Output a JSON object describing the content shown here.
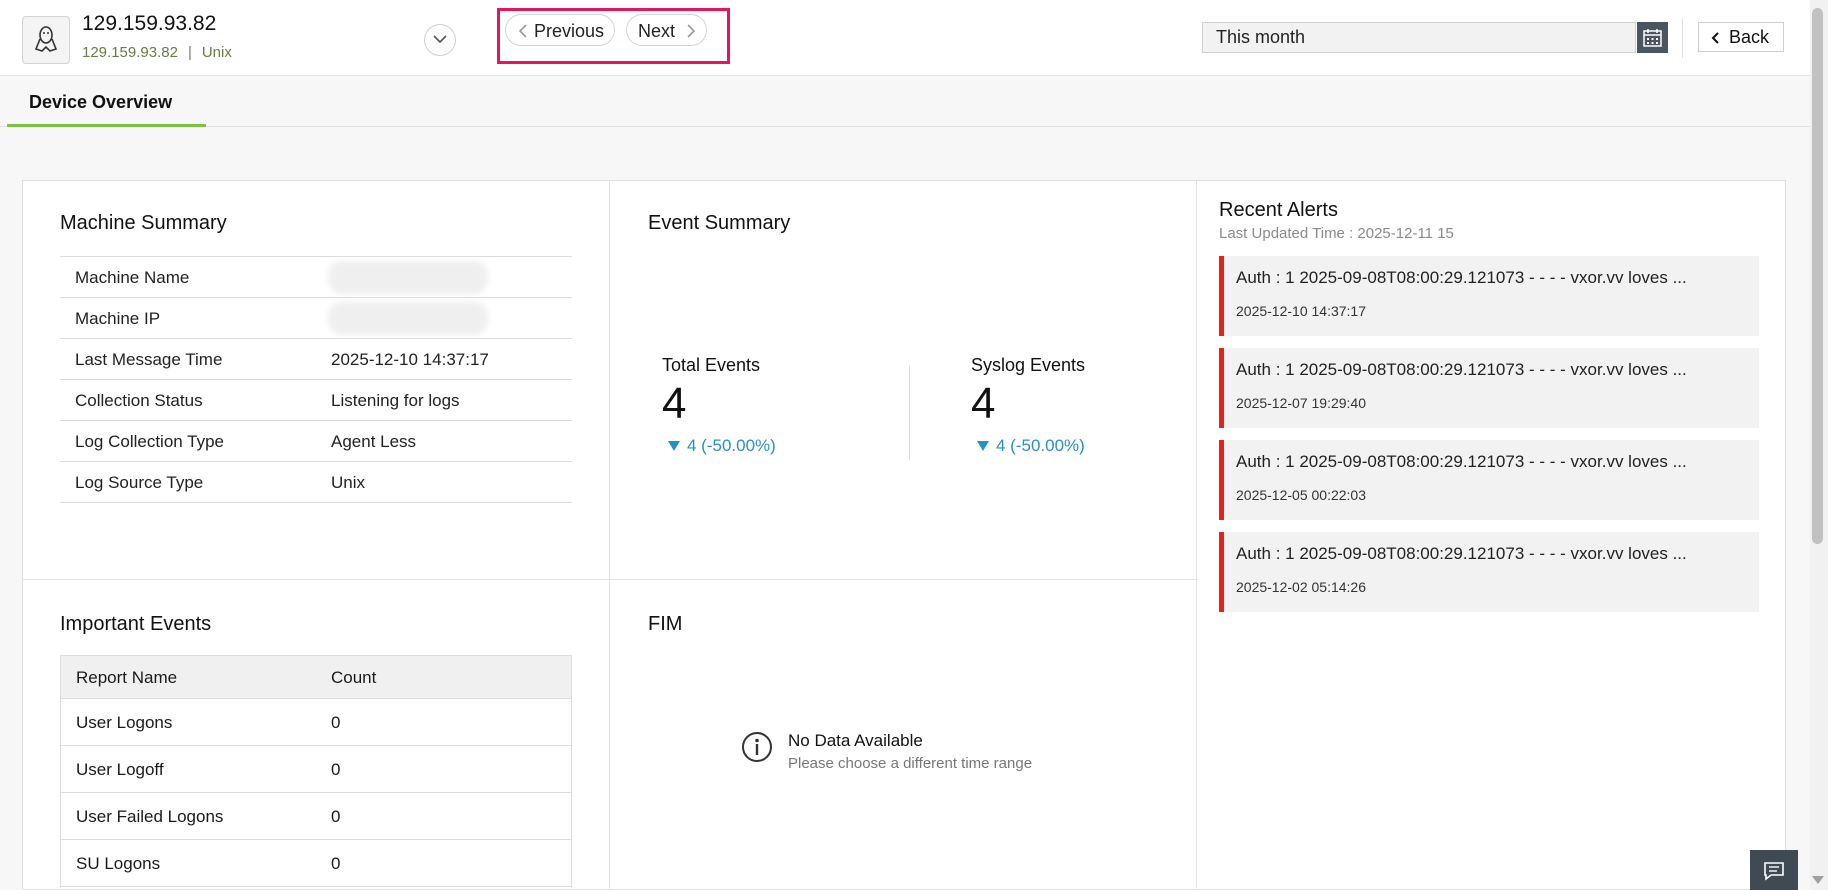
{
  "device": {
    "name": "129.159.93.82",
    "ip": "129.159.93.82",
    "separator": "|",
    "os": "Unix",
    "icon": "linux-tux-icon"
  },
  "nav": {
    "previous_label": "Previous",
    "next_label": "Next"
  },
  "date_filter": {
    "value": "This month",
    "icon": "calendar-icon"
  },
  "back_label": "Back",
  "tabs": [
    {
      "label": "Device Overview",
      "active": true
    }
  ],
  "machine_summary": {
    "title": "Machine Summary",
    "rows": [
      {
        "key": "Machine Name",
        "value": ""
      },
      {
        "key": "Machine IP",
        "value": ""
      },
      {
        "key": "Last Message Time",
        "value": "2025-12-10 14:37:17"
      },
      {
        "key": "Collection Status",
        "value": "Listening for logs"
      },
      {
        "key": "Log Collection Type",
        "value": "Agent Less"
      },
      {
        "key": "Log Source Type",
        "value": "Unix"
      }
    ]
  },
  "event_summary": {
    "title": "Event Summary",
    "total": {
      "label": "Total Events",
      "value": "4",
      "change": "4 (-50.00%)"
    },
    "syslog": {
      "label": "Syslog Events",
      "value": "4",
      "change": "4 (-50.00%)"
    }
  },
  "recent_alerts": {
    "title": "Recent Alerts",
    "updated": "Last Updated Time : 2025-12-11 15",
    "items": [
      {
        "message": "Auth : 1 2025-09-08T08:00:29.121073 - - - - vxor.vv loves ...",
        "time": "2025-12-10 14:37:17"
      },
      {
        "message": "Auth : 1 2025-09-08T08:00:29.121073 - - - - vxor.vv loves ...",
        "time": "2025-12-07 19:29:40"
      },
      {
        "message": "Auth : 1 2025-09-08T08:00:29.121073 - - - - vxor.vv loves ...",
        "time": "2025-12-05 00:22:03"
      },
      {
        "message": "Auth : 1 2025-09-08T08:00:29.121073 - - - - vxor.vv loves ...",
        "time": "2025-12-02 05:14:26"
      }
    ],
    "accent_color": "#e1231c"
  },
  "important_events": {
    "title": "Important Events",
    "columns": [
      "Report Name",
      "Count"
    ],
    "rows": [
      {
        "name": "User Logons",
        "count": "0"
      },
      {
        "name": "User Logoff",
        "count": "0"
      },
      {
        "name": "User Failed Logons",
        "count": "0"
      },
      {
        "name": "SU Logons",
        "count": "0"
      }
    ]
  },
  "fim": {
    "title": "FIM",
    "no_data": "No Data Available",
    "hint": "Please choose a different time range"
  },
  "colors": {
    "highlight_box": "#e8135a",
    "tab_accent": "#7cc242",
    "change_blue": "#2a8fc8"
  }
}
